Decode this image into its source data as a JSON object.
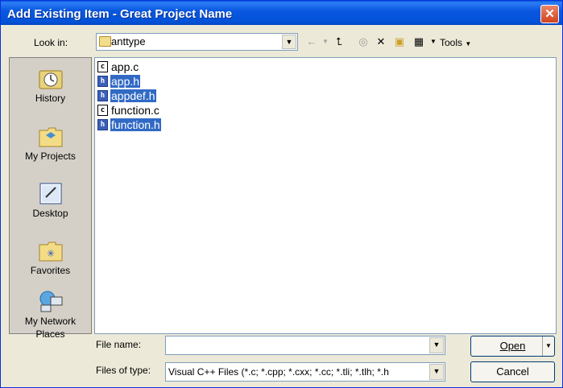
{
  "window": {
    "title": "Add Existing Item - Great Project Name",
    "close_glyph": "✕"
  },
  "lookin": {
    "label": "Look in:",
    "value": "anttype"
  },
  "toolbar": {
    "tools_label": "Tools"
  },
  "places": [
    {
      "label": "History",
      "icon": "history-icon"
    },
    {
      "label": "My Projects",
      "icon": "folder-icon"
    },
    {
      "label": "Desktop",
      "icon": "desktop-icon"
    },
    {
      "label": "Favorites",
      "icon": "favorites-icon"
    },
    {
      "label": "My Network Places",
      "icon": "network-icon"
    }
  ],
  "files": [
    {
      "name": "app.c",
      "type": "c",
      "selected": false
    },
    {
      "name": "app.h",
      "type": "h",
      "selected": true
    },
    {
      "name": "appdef.h",
      "type": "h",
      "selected": true
    },
    {
      "name": "function.c",
      "type": "c",
      "selected": false
    },
    {
      "name": "function.h",
      "type": "h",
      "selected": true
    }
  ],
  "filename": {
    "label": "File name:",
    "value": ""
  },
  "filetype": {
    "label": "Files of type:",
    "value": "Visual C++ Files (*.c; *.cpp; *.cxx; *.cc; *.tli; *.tlh; *.h"
  },
  "buttons": {
    "open": "Open",
    "cancel": "Cancel"
  },
  "colors": {
    "selection": "#316ac5",
    "titlebar": "#0a58e0"
  }
}
